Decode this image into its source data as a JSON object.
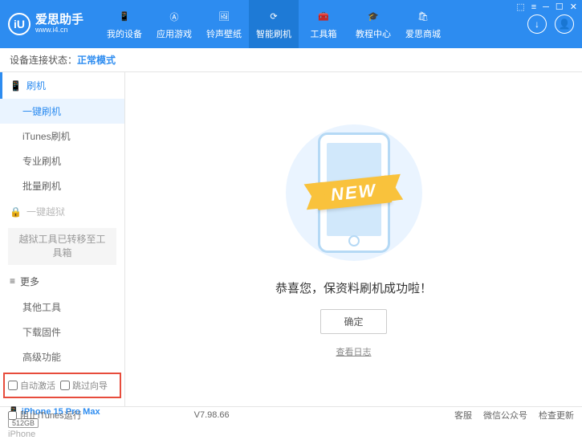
{
  "app": {
    "name": "爱思助手",
    "url": "www.i4.cn",
    "logo_letter": "iU"
  },
  "nav": {
    "items": [
      {
        "label": "我的设备"
      },
      {
        "label": "应用游戏"
      },
      {
        "label": "铃声壁纸"
      },
      {
        "label": "智能刷机"
      },
      {
        "label": "工具箱"
      },
      {
        "label": "教程中心"
      },
      {
        "label": "爱思商城"
      }
    ],
    "active_index": 3
  },
  "status": {
    "label": "设备连接状态：",
    "mode": "正常模式"
  },
  "sidebar": {
    "group1_label": "刷机",
    "group1_items": [
      "一键刷机",
      "iTunes刷机",
      "专业刷机",
      "批量刷机"
    ],
    "group1_active": 0,
    "group2_label": "一键越狱",
    "group2_notice": "越狱工具已转移至工具箱",
    "group3_label": "更多",
    "group3_items": [
      "其他工具",
      "下载固件",
      "高级功能"
    ],
    "checkboxes": {
      "auto_activate": "自动激活",
      "skip_guide": "跳过向导"
    },
    "device": {
      "name": "iPhone 15 Pro Max",
      "capacity": "512GB",
      "type": "iPhone"
    }
  },
  "main": {
    "ribbon": "NEW",
    "success": "恭喜您，保资料刷机成功啦！",
    "ok": "确定",
    "log": "查看日志"
  },
  "footer": {
    "block_itunes": "阻止iTunes运行",
    "version": "V7.98.66",
    "links": [
      "客服",
      "微信公众号",
      "检查更新"
    ]
  }
}
